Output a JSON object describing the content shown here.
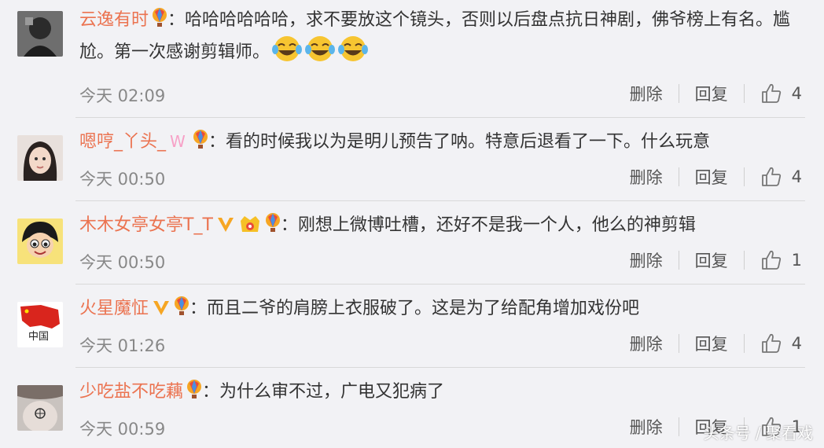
{
  "comments": [
    {
      "username": "云逸有时",
      "colon": "：",
      "text": "哈哈哈哈哈哈，求不要放这个镜头，否则以后盘点抗日神剧，佛爷榜上有名。尴尬。第一次感谢剪辑师。",
      "time": "今天 02:09",
      "delete": "删除",
      "reply": "回复",
      "likes": "4",
      "badges": [
        "balloon-badge-icon"
      ],
      "emoji_count": 3
    },
    {
      "username": "嗯哼_丫头_",
      "colon": "：",
      "text": "看的时候我以为是明儿预告了呐。特意后退看了一下。什么玩意",
      "time": "今天 00:50",
      "delete": "删除",
      "reply": "回复",
      "likes": "4",
      "badges": [
        "w-badge-icon",
        "balloon-badge-icon"
      ]
    },
    {
      "username": "木木女亭女亭T_T",
      "colon": "：",
      "text": "刚想上微博吐槽，还好不是我一个人，他么的神剪辑",
      "time": "今天 00:50",
      "delete": "删除",
      "reply": "回复",
      "likes": "1",
      "badges": [
        "verified-v-icon",
        "crown-badge-icon",
        "balloon-badge-icon"
      ]
    },
    {
      "username": "火星魔怔",
      "colon": "：",
      "text": "而且二爷的肩膀上衣服破了。这是为了给配角增加戏份吧",
      "time": "今天 01:26",
      "delete": "删除",
      "reply": "回复",
      "likes": "4",
      "badges": [
        "verified-v-icon",
        "balloon-badge-icon"
      ],
      "avatar_text": "中国"
    },
    {
      "username": "少吃盐不吃藕",
      "colon": "：",
      "text": "为什么审不过，广电又犯病了",
      "time": "今天 00:59",
      "delete": "删除",
      "reply": "回复",
      "likes": "1",
      "badges": [
        "balloon-badge-icon"
      ]
    }
  ],
  "watermark": "头条号 / 聚看戏",
  "colors": {
    "username": "#eb7350",
    "text": "#333333",
    "meta": "#888888",
    "background": "#f2f2f5",
    "divider": "#d9d9d9"
  }
}
